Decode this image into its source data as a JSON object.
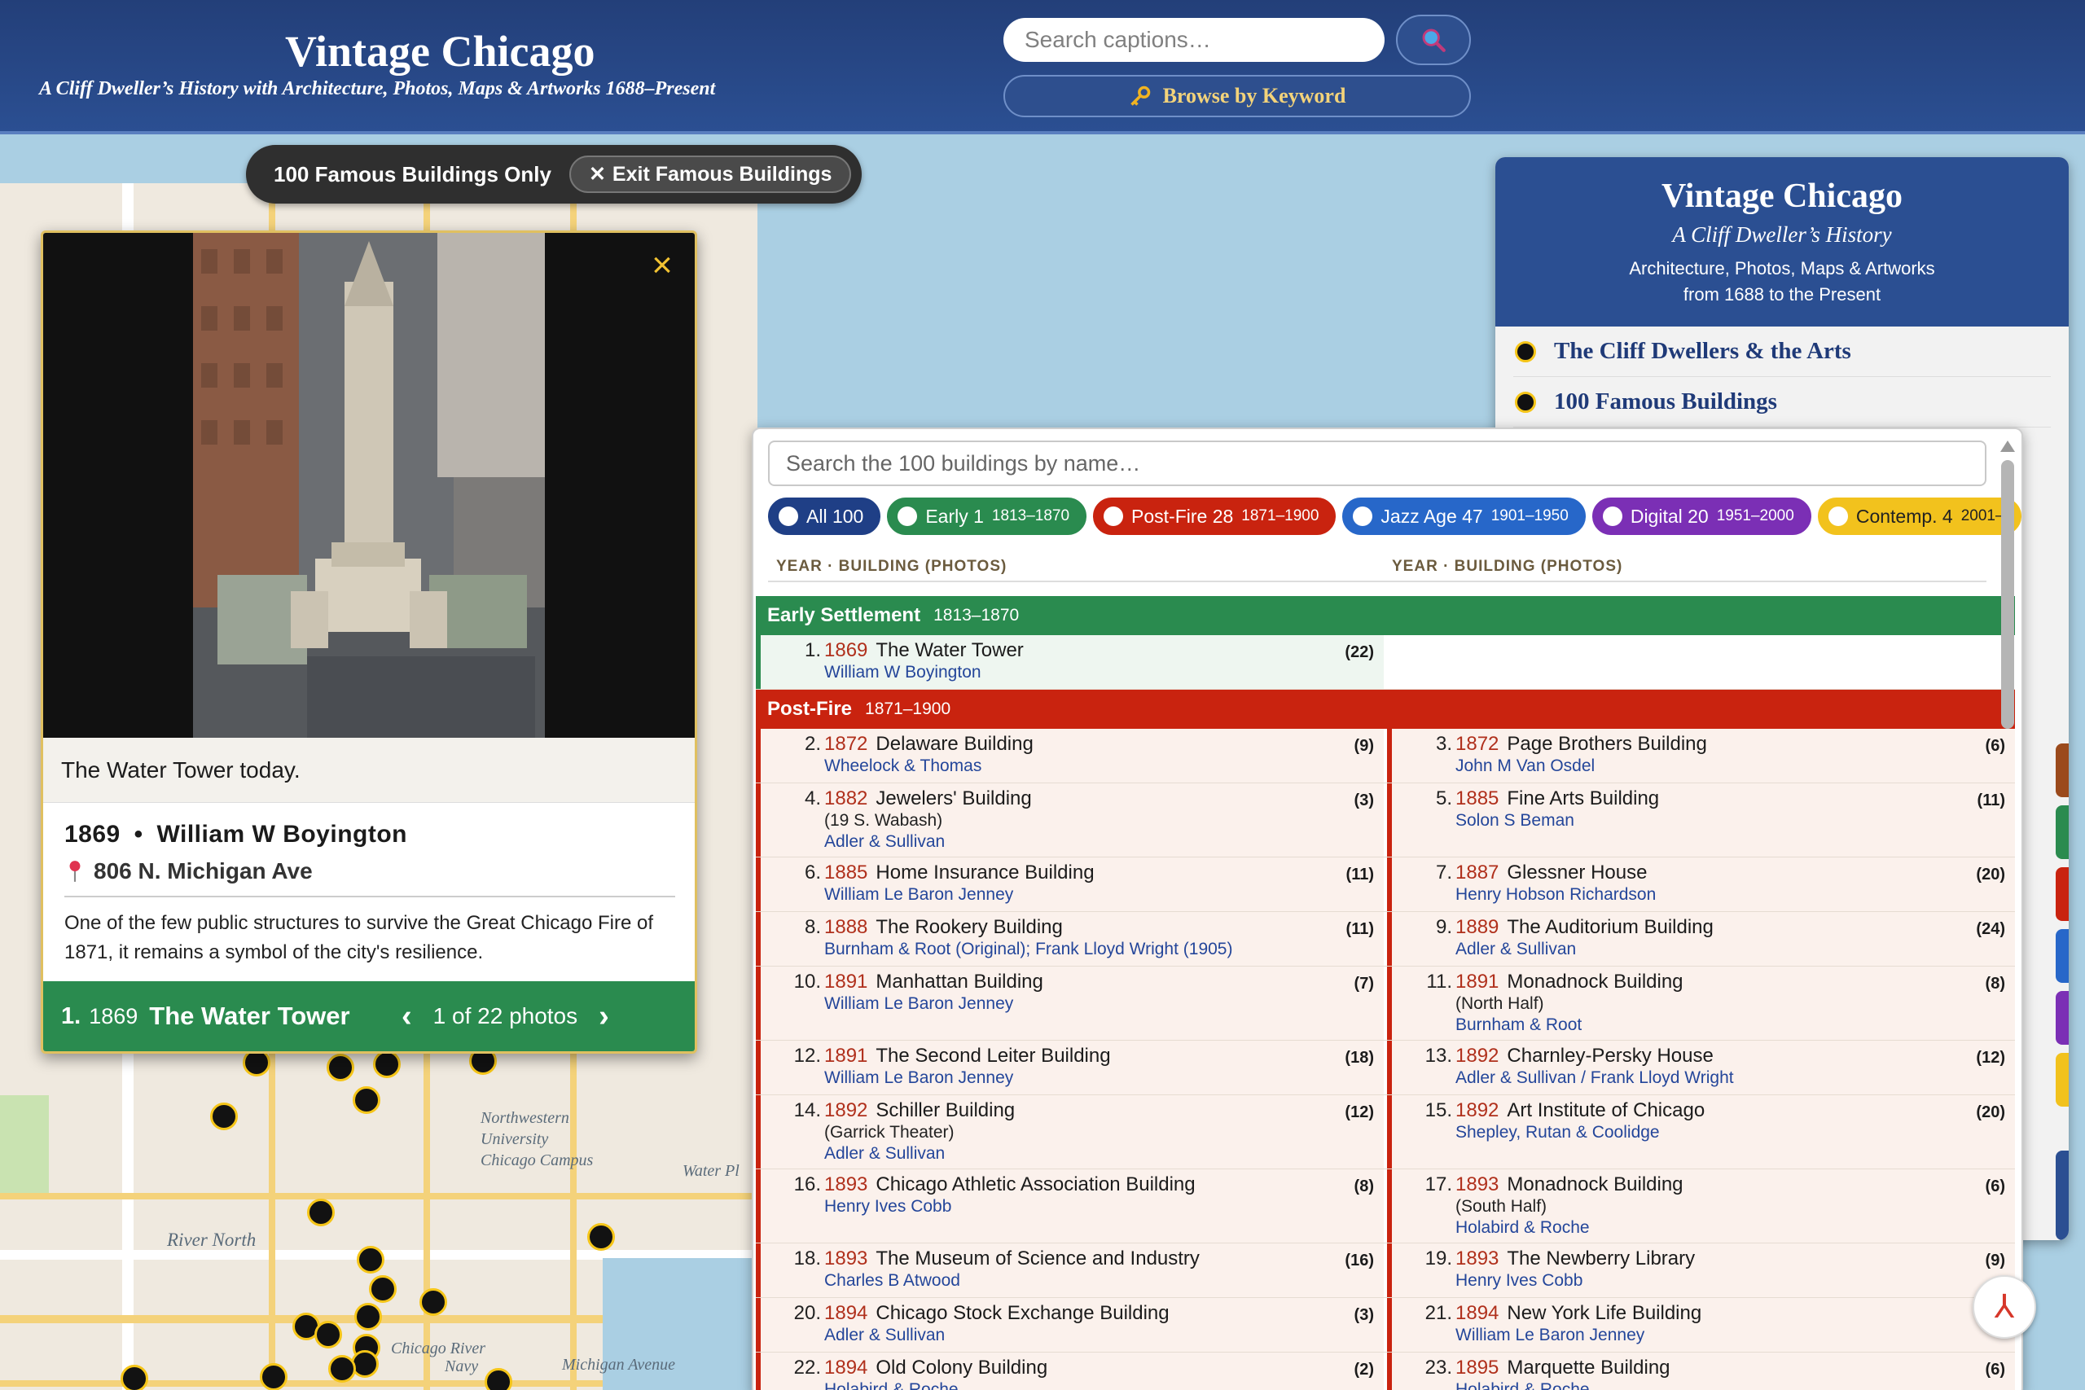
{
  "header": {
    "title": "Vintage Chicago",
    "subtitle": "A Cliff Dweller’s History with Architecture, Photos, Maps & Artworks 1688–Present",
    "search_placeholder": "Search captions…",
    "search_icon": "magnifier-icon",
    "keyword_label": "Browse by Keyword",
    "keyword_icon": "key-icon"
  },
  "filter": {
    "label": "100 Famous Buildings Only",
    "exit_label": "Exit Famous Buildings"
  },
  "map": {
    "labels": [
      "Northwestern University Chicago Campus",
      "River North",
      "Water Pl",
      "Chicago River",
      "Michigan Avenue",
      "Navy"
    ]
  },
  "popup": {
    "photo_caption": "The Water Tower today.",
    "year": "1869",
    "separator": "•",
    "architect": "William W Boyington",
    "address": "806 N. Michigan Ave",
    "description": "One of the few public structures to survive the Great Chicago Fire of 1871, it remains a symbol of the city's resilience.",
    "footer_num": "1.",
    "footer_year": "1869",
    "footer_title": "The Water Tower",
    "photo_counter": "1 of 22 photos",
    "prev": "‹",
    "next": "›"
  },
  "info": {
    "title": "Vintage Chicago",
    "subtitle": "A Cliff Dweller’s History",
    "desc1": "Architecture, Photos, Maps & Artworks",
    "desc2": "from 1688 to the Present",
    "links": [
      "The Cliff Dwellers & the Arts",
      "100 Famous Buildings"
    ]
  },
  "list": {
    "search_placeholder": "Search the 100 buildings by name…",
    "chips": [
      {
        "label": "All 100",
        "range": "",
        "color": "#1f3f86"
      },
      {
        "label": "Early 1",
        "range": "1813–1870",
        "color": "#2a8b4f"
      },
      {
        "label": "Post-Fire 28",
        "range": "1871–1900",
        "color": "#c9230f"
      },
      {
        "label": "Jazz Age 47",
        "range": "1901–1950",
        "color": "#2767c9"
      },
      {
        "label": "Digital 20",
        "range": "1951–2000",
        "color": "#7b2fb5"
      },
      {
        "label": "Contemp. 4",
        "range": "2001–",
        "color": "#f2c21d"
      }
    ],
    "col_head": "YEAR · BUILDING (PHOTOS)",
    "eras": [
      {
        "name": "Early Settlement",
        "range": "1813–1870",
        "color": "#2a8b4f",
        "rows": [
          [
            {
              "n": "1.",
              "y": "1869",
              "t": "The Water Tower",
              "s": [
                "William W Boyington"
              ],
              "p": "(22)"
            }
          ]
        ]
      },
      {
        "name": "Post-Fire",
        "range": "1871–1900",
        "color": "#c9230f",
        "rows": [
          [
            {
              "n": "2.",
              "y": "1872",
              "t": "Delaware Building",
              "s": [
                "Wheelock & Thomas"
              ],
              "p": "(9)"
            },
            {
              "n": "3.",
              "y": "1872",
              "t": "Page Brothers Building",
              "s": [
                "John M Van Osdel"
              ],
              "p": "(6)"
            }
          ],
          [
            {
              "n": "4.",
              "y": "1882",
              "t": "Jewelers' Building",
              "note": "(19 S. Wabash)",
              "s": [
                "Adler & Sullivan"
              ],
              "p": "(3)"
            },
            {
              "n": "5.",
              "y": "1885",
              "t": "Fine Arts Building",
              "s": [
                "Solon S Beman"
              ],
              "p": "(11)"
            }
          ],
          [
            {
              "n": "6.",
              "y": "1885",
              "t": "Home Insurance Building",
              "s": [
                "William Le Baron Jenney"
              ],
              "p": "(11)"
            },
            {
              "n": "7.",
              "y": "1887",
              "t": "Glessner House",
              "s": [
                "Henry Hobson Richardson"
              ],
              "p": "(20)"
            }
          ],
          [
            {
              "n": "8.",
              "y": "1888",
              "t": "The Rookery Building",
              "s": [
                "Burnham & Root (Original); Frank Lloyd Wright (1905)"
              ],
              "p": "(11)"
            },
            {
              "n": "9.",
              "y": "1889",
              "t": "The Auditorium Building",
              "s": [
                "Adler & Sullivan"
              ],
              "p": "(24)"
            }
          ],
          [
            {
              "n": "10.",
              "y": "1891",
              "t": "Manhattan Building",
              "s": [
                "William Le Baron Jenney"
              ],
              "p": "(7)"
            },
            {
              "n": "11.",
              "y": "1891",
              "t": "Monadnock Building",
              "note": "(North Half)",
              "s": [
                "Burnham & Root"
              ],
              "p": "(8)"
            }
          ],
          [
            {
              "n": "12.",
              "y": "1891",
              "t": "The Second Leiter Building",
              "s": [
                "William Le Baron Jenney"
              ],
              "p": "(18)"
            },
            {
              "n": "13.",
              "y": "1892",
              "t": "Charnley-Persky House",
              "s": [
                "Adler & Sullivan / Frank Lloyd Wright"
              ],
              "p": "(12)"
            }
          ],
          [
            {
              "n": "14.",
              "y": "1892",
              "t": "Schiller Building",
              "note": "(Garrick Theater)",
              "s": [
                "Adler & Sullivan"
              ],
              "p": "(12)"
            },
            {
              "n": "15.",
              "y": "1892",
              "t": "Art Institute of Chicago",
              "s": [
                "Shepley, Rutan & Coolidge"
              ],
              "p": "(20)"
            }
          ],
          [
            {
              "n": "16.",
              "y": "1893",
              "t": "Chicago Athletic Association Building",
              "s": [
                "Henry Ives Cobb"
              ],
              "p": "(8)"
            },
            {
              "n": "17.",
              "y": "1893",
              "t": "Monadnock Building",
              "note": "(South Half)",
              "s": [
                "Holabird & Roche"
              ],
              "p": "(6)"
            }
          ],
          [
            {
              "n": "18.",
              "y": "1893",
              "t": "The Museum of Science and Industry",
              "s": [
                "Charles B Atwood"
              ],
              "p": "(16)"
            },
            {
              "n": "19.",
              "y": "1893",
              "t": "The Newberry Library",
              "s": [
                "Henry Ives Cobb"
              ],
              "p": "(9)"
            }
          ],
          [
            {
              "n": "20.",
              "y": "1894",
              "t": "Chicago Stock Exchange Building",
              "s": [
                "Adler & Sullivan"
              ],
              "p": "(3)"
            },
            {
              "n": "21.",
              "y": "1894",
              "t": "New York Life Building",
              "s": [
                "William Le Baron Jenney"
              ],
              "p": "(3)"
            }
          ],
          [
            {
              "n": "22.",
              "y": "1894",
              "t": "Old Colony Building",
              "s": [
                "Holabird & Roche"
              ],
              "p": "(2)"
            },
            {
              "n": "23.",
              "y": "1895",
              "t": "Marquette Building",
              "s": [
                "Holabird & Roche"
              ],
              "p": "(6)"
            }
          ]
        ]
      }
    ]
  }
}
